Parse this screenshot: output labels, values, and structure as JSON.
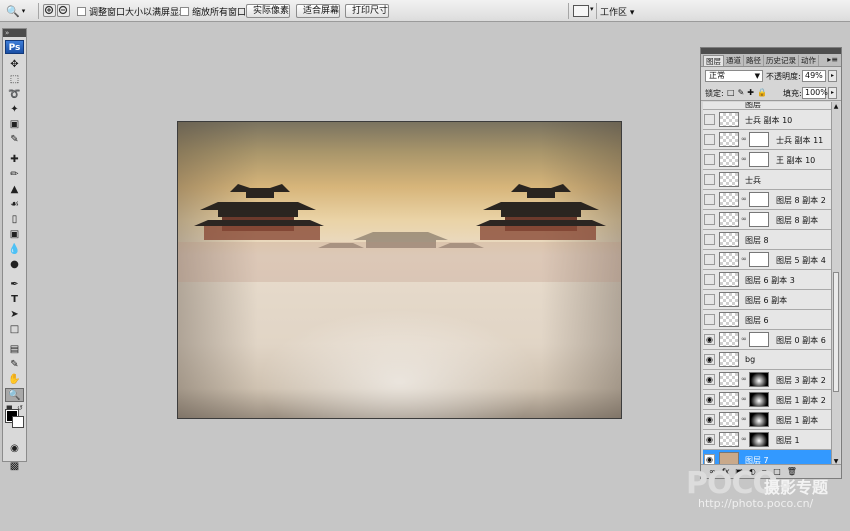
{
  "optionsbar": {
    "tool_icon": "zoom-tool-icon",
    "checkbox_resize": "调整窗口大小以满屏显示",
    "checkbox_zoom_all": "缩放所有窗口",
    "btn_actual_pixels": "实际像素",
    "btn_fit_screen": "适合屏幕",
    "btn_print_size": "打印尺寸",
    "workspace_label": "工作区 ▾"
  },
  "toolbox": {
    "logo": "Ps",
    "tools": [
      "move",
      "marquee",
      "lasso",
      "magic-wand",
      "crop",
      "slice",
      "healing",
      "brush",
      "clone-stamp",
      "history-brush",
      "eraser",
      "gradient",
      "blur",
      "dodge",
      "pen",
      "type",
      "path-select",
      "shape",
      "notes",
      "eyedropper",
      "hand",
      "zoom"
    ],
    "active_tool": "zoom",
    "foreground_color": "#000000",
    "background_color": "#ffffff"
  },
  "layers_panel": {
    "tabs": [
      "图层",
      "通道",
      "路径",
      "历史记录",
      "动作"
    ],
    "active_tab": "图层",
    "blend_mode": "正常",
    "opacity_label": "不透明度:",
    "opacity_value": "49%",
    "lock_label": "锁定:",
    "fill_label": "填充:",
    "fill_value": "100%",
    "layers": [
      {
        "name": "图层",
        "visible": false,
        "has_mask": false,
        "partial": true
      },
      {
        "name": "士兵 副本 10",
        "visible": false,
        "has_mask": false
      },
      {
        "name": "士兵 副本 11",
        "visible": false,
        "has_mask": true
      },
      {
        "name": "王 副本 10",
        "visible": false,
        "has_mask": true
      },
      {
        "name": "士兵",
        "visible": false,
        "has_mask": false
      },
      {
        "name": "图层 8 副本 2",
        "visible": false,
        "has_mask": true
      },
      {
        "name": "图层 8 副本",
        "visible": false,
        "has_mask": true
      },
      {
        "name": "图层 8",
        "visible": false,
        "has_mask": false
      },
      {
        "name": "图层 5 副本 4",
        "visible": false,
        "has_mask": true
      },
      {
        "name": "图层 6 副本 3",
        "visible": false,
        "has_mask": false
      },
      {
        "name": "图层 6 副本",
        "visible": false,
        "has_mask": false
      },
      {
        "name": "图层 6",
        "visible": false,
        "has_mask": false
      },
      {
        "name": "图层 0 副本 6",
        "visible": true,
        "has_mask": true
      },
      {
        "name": "bg",
        "visible": true,
        "has_mask": false
      },
      {
        "name": "图层 3 副本 2",
        "visible": true,
        "has_mask": true
      },
      {
        "name": "图层 1 副本 2",
        "visible": true,
        "has_mask": true
      },
      {
        "name": "图层 1 副本",
        "visible": true,
        "has_mask": true
      },
      {
        "name": "图层 1",
        "visible": true,
        "has_mask": true
      },
      {
        "name": "图层 7",
        "visible": true,
        "has_mask": false,
        "selected": true
      }
    ]
  },
  "watermark": {
    "logo": "POCO",
    "title": "摄影专题",
    "url": "http://photo.poco.cn/"
  }
}
